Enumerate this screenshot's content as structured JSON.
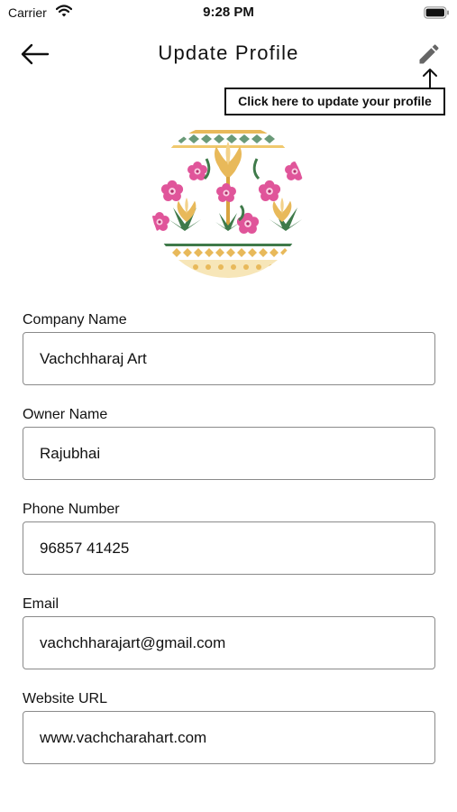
{
  "status_bar": {
    "carrier": "Carrier",
    "time": "9:28 PM",
    "wifi_icon": "wifi-icon",
    "battery_icon": "battery-icon"
  },
  "nav": {
    "title": "Update Profile",
    "back_icon": "arrow-left-icon",
    "edit_icon": "pencil-icon"
  },
  "tooltip": {
    "text": "Click here to update your profile"
  },
  "avatar": {
    "image": "floral-embroidery-pattern"
  },
  "form": {
    "fields": [
      {
        "label": "Company Name",
        "value": "Vachchharaj Art"
      },
      {
        "label": "Owner Name",
        "value": "Rajubhai"
      },
      {
        "label": "Phone Number",
        "value": "96857 41425"
      },
      {
        "label": "Email",
        "value": "vachchharajart@gmail.com"
      },
      {
        "label": "Website URL",
        "value": "www.vachcharahart.com"
      }
    ]
  },
  "colors": {
    "text": "#111111",
    "input_border": "#8a8a8a",
    "edit_icon": "#666666",
    "pattern_pink": "#e0559a",
    "pattern_gold": "#e8b95a",
    "pattern_green": "#3f7a4a"
  }
}
